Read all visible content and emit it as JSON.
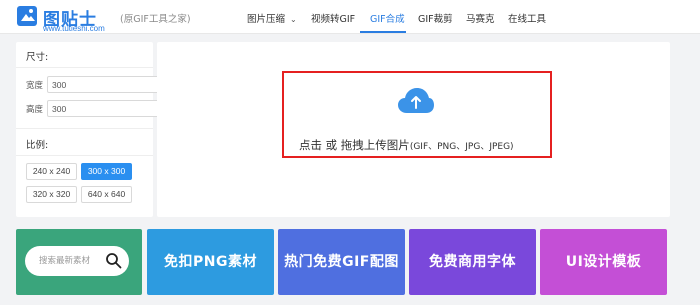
{
  "header": {
    "logo_text": "图贴士",
    "logo_url": "www.tutieshi.com",
    "subtitle": "(原GIF工具之家)",
    "nav": [
      {
        "label": "图片压缩",
        "has_dropdown": true,
        "active": false
      },
      {
        "label": "视频转GIF",
        "active": false
      },
      {
        "label": "GIF合成",
        "active": true
      },
      {
        "label": "GIF裁剪",
        "active": false
      },
      {
        "label": "马赛克",
        "active": false
      },
      {
        "label": "在线工具",
        "active": false
      }
    ]
  },
  "settings": {
    "size_title": "尺寸:",
    "width_label": "宽度",
    "width_value": "300",
    "height_label": "高度",
    "height_value": "300",
    "ratio_title": "比例:",
    "ratios": [
      "240 x 240",
      "300 x 300",
      "320 x 320",
      "640 x 640"
    ],
    "ratio_selected": "300 x 300"
  },
  "upload": {
    "icon": "cloud-upload-icon",
    "text": "点击 或 拖拽上传图片",
    "formats": "(GIF、PNG、JPG、JPEG)"
  },
  "banners": {
    "search_placeholder": "搜索最新素材",
    "items": [
      {
        "label": "免扣PNG素材",
        "color": "#2d9be0"
      },
      {
        "label": "热门免费GIF配图",
        "color": "#4f6fe0"
      },
      {
        "label": "免费商用字体",
        "color": "#7a48db"
      },
      {
        "label": "UI设计模板",
        "color": "#c44fd6"
      }
    ],
    "search_card_color": "#3aa57c"
  },
  "colors": {
    "accent": "#2a7de1",
    "upload_border": "#e52020"
  }
}
